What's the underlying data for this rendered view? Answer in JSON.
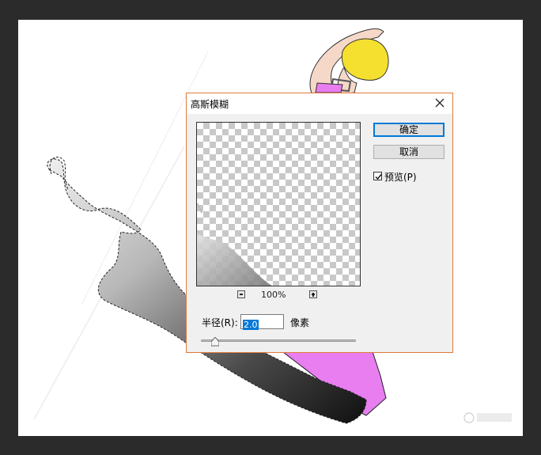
{
  "dialog": {
    "title": "高斯模糊",
    "ok_label": "确定",
    "cancel_label": "取消",
    "preview_label": "预览(P)",
    "preview_checked": true,
    "zoom_label": "100%",
    "radius_label": "半径(R):",
    "radius_value": "2.0",
    "unit_label": "像素"
  },
  "colors": {
    "dialog_border": "#e07a3a",
    "ok_focus": "#0078d7",
    "skirt": "#e87ef0",
    "hair": "#f5e030"
  },
  "icons": [
    "close-icon",
    "zoom-out-icon",
    "zoom-in-icon",
    "checkmark-icon"
  ]
}
